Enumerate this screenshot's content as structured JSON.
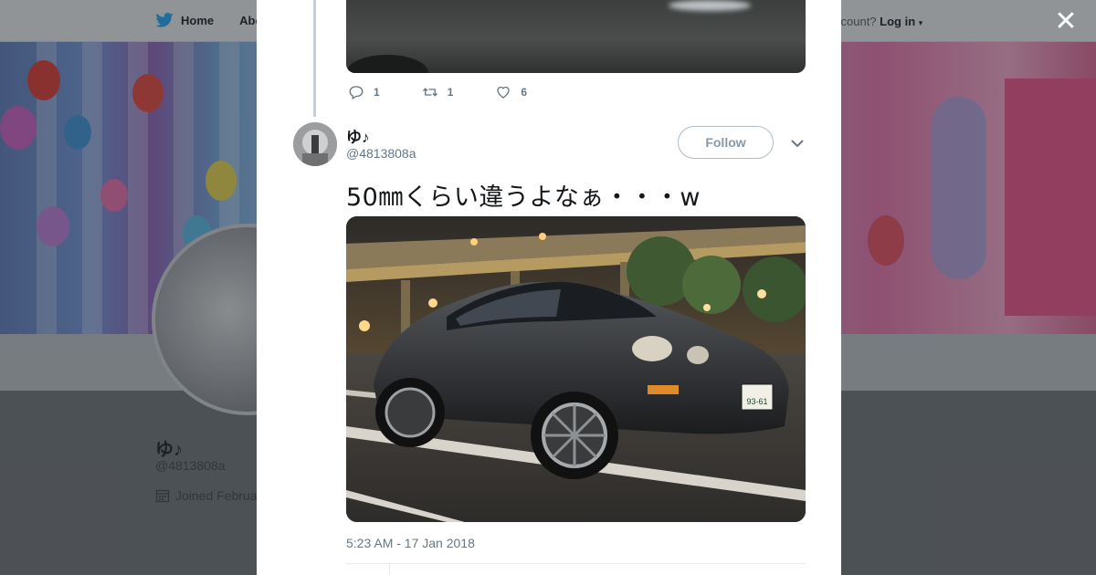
{
  "background": {
    "nav": {
      "home_label": "Home",
      "about_label": "Abo",
      "login_prefix": "ccount?",
      "login_label": "Log in"
    },
    "profile": {
      "name": "ゆ♪",
      "handle": "@4813808a",
      "joined": "Joined Februa"
    }
  },
  "tweet_prev": {
    "replies": "1",
    "retweets": "1",
    "likes": "6"
  },
  "tweet": {
    "author_name": "ゆ♪",
    "author_handle": "@4813808a",
    "follow_label": "Follow",
    "text": "50㎜くらい違うよなぁ・・・w",
    "plate": "93-61",
    "timestamp": "5:23 AM - 17 Jan 2018"
  },
  "icons": [
    "twitter-bird-icon",
    "close-icon",
    "reply-icon",
    "retweet-icon",
    "like-icon",
    "chevron-down-icon",
    "calendar-icon"
  ],
  "colors": {
    "link": "#1da1f2",
    "muted": "#657786",
    "text": "#14171a"
  }
}
